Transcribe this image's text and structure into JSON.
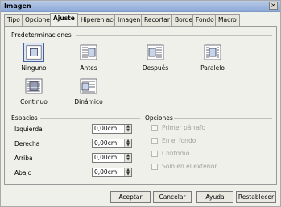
{
  "window": {
    "title": "Imagen",
    "close": "×"
  },
  "tabs": [
    {
      "label": "Tipo"
    },
    {
      "label": "Opciones"
    },
    {
      "label": "Ajuste"
    },
    {
      "label": "Hiperenlace"
    },
    {
      "label": "Imagen"
    },
    {
      "label": "Recortar"
    },
    {
      "label": "Borde"
    },
    {
      "label": "Fondo"
    },
    {
      "label": "Macro"
    }
  ],
  "active_tab": "Ajuste",
  "presets": {
    "title": "Predeterminaciones",
    "items": [
      {
        "label": "Ninguno",
        "icon": "wrap-none-icon"
      },
      {
        "label": "Antes",
        "icon": "wrap-before-icon"
      },
      {
        "label": "Después",
        "icon": "wrap-after-icon"
      },
      {
        "label": "Paralelo",
        "icon": "wrap-parallel-icon"
      },
      {
        "label": "Continuo",
        "icon": "wrap-through-icon"
      },
      {
        "label": "Dinámico",
        "icon": "wrap-optimal-icon"
      }
    ],
    "selected": "Ninguno"
  },
  "spacing": {
    "title": "Espacios",
    "rows": [
      {
        "label": "Izquierda",
        "value": "0,00cm"
      },
      {
        "label": "Derecha",
        "value": "0,00cm"
      },
      {
        "label": "Arriba",
        "value": "0,00cm"
      },
      {
        "label": "Abajo",
        "value": "0,00cm"
      }
    ]
  },
  "options": {
    "title": "Opciones",
    "items": [
      {
        "label": "Primer párrafo",
        "checked": false,
        "enabled": false
      },
      {
        "label": "En el fondo",
        "checked": false,
        "enabled": false
      },
      {
        "label": "Contorno",
        "checked": false,
        "enabled": false
      },
      {
        "label": "Solo en el exterior",
        "checked": false,
        "enabled": false
      }
    ]
  },
  "buttons": {
    "accept": "Aceptar",
    "cancel": "Cancelar",
    "help": "Ayuda",
    "reset": "Restablecer"
  },
  "colors": {
    "title_bar": "#8da8d8",
    "selected_preset_border": "#4060a0"
  }
}
